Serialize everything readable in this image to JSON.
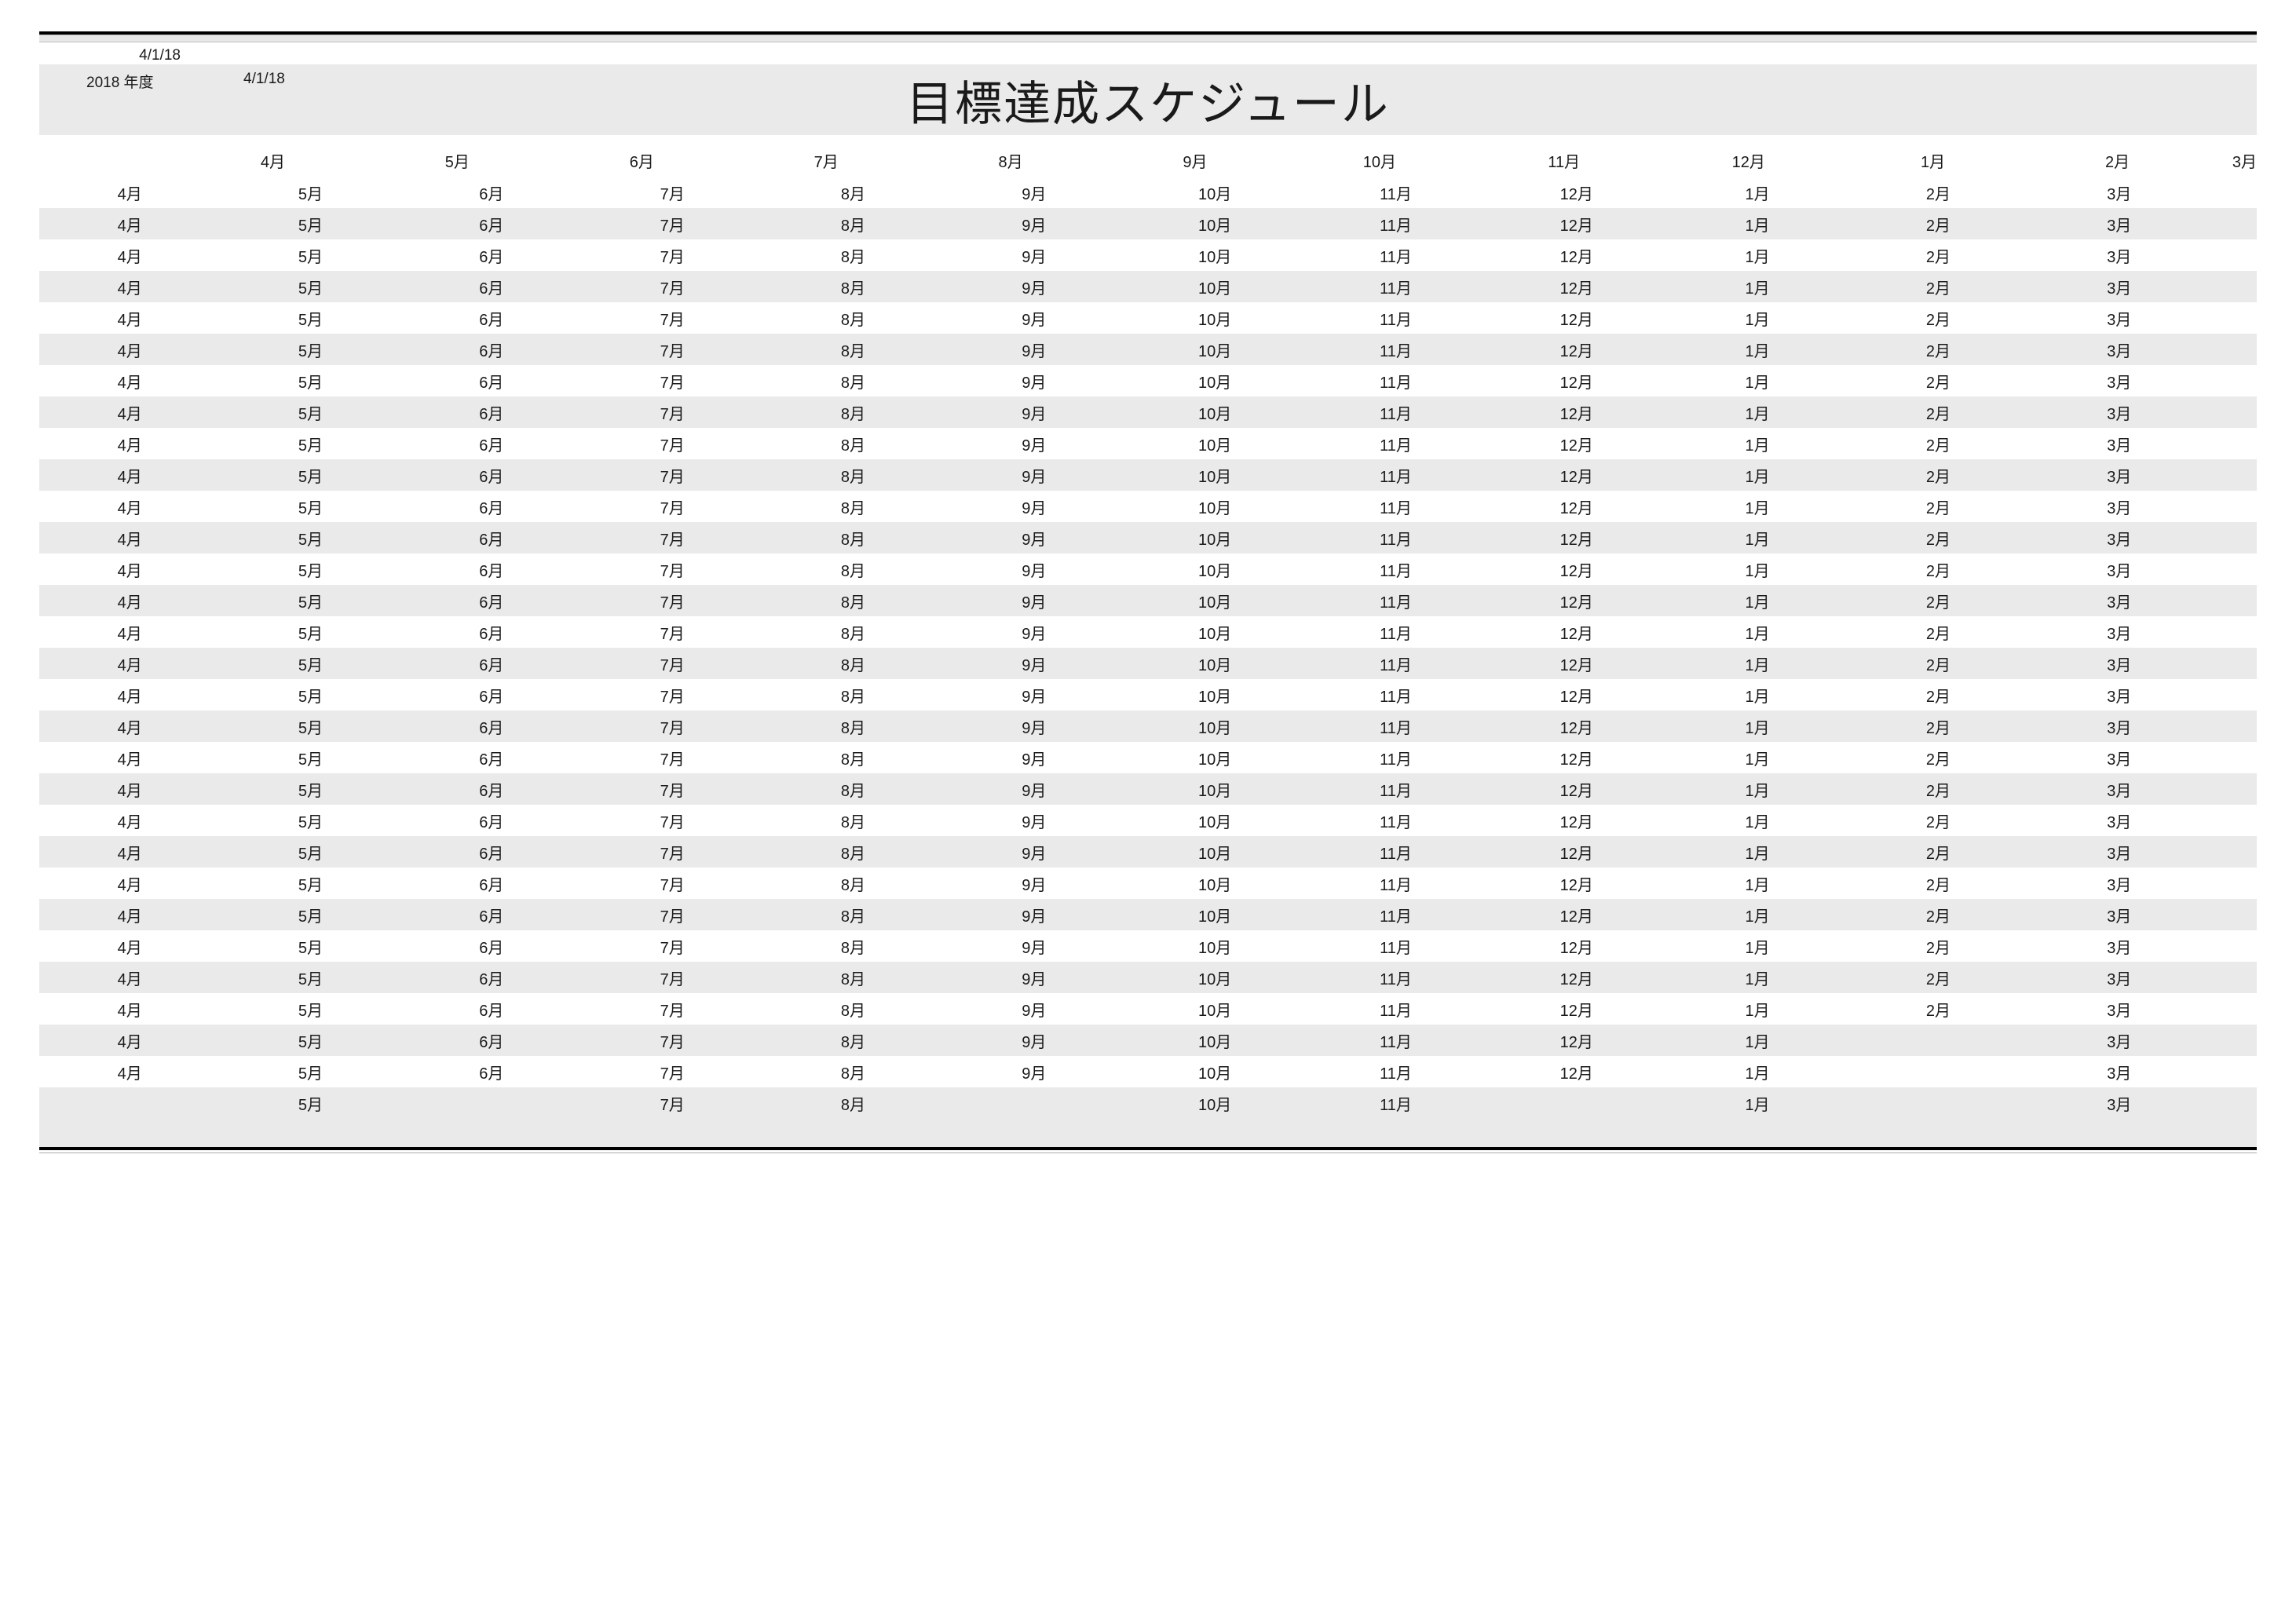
{
  "meta": {
    "date1": "4/1/18",
    "year_label": "2018 年度",
    "date2": "4/1/18",
    "title": "目標達成スケジュール"
  },
  "header_months": [
    "4月",
    "5月",
    "6月",
    "7月",
    "8月",
    "9月",
    "10月",
    "11月",
    "12月",
    "1月",
    "2月"
  ],
  "header_trail": "3月",
  "data_months": [
    "4月",
    "5月",
    "6月",
    "7月",
    "8月",
    "9月",
    "10月",
    "11月",
    "12月",
    "1月",
    "2月",
    "3月"
  ],
  "rows": [
    {
      "omit": []
    },
    {
      "omit": []
    },
    {
      "omit": []
    },
    {
      "omit": []
    },
    {
      "omit": []
    },
    {
      "omit": []
    },
    {
      "omit": []
    },
    {
      "omit": []
    },
    {
      "omit": []
    },
    {
      "omit": []
    },
    {
      "omit": []
    },
    {
      "omit": []
    },
    {
      "omit": []
    },
    {
      "omit": []
    },
    {
      "omit": []
    },
    {
      "omit": []
    },
    {
      "omit": []
    },
    {
      "omit": []
    },
    {
      "omit": []
    },
    {
      "omit": []
    },
    {
      "omit": []
    },
    {
      "omit": []
    },
    {
      "omit": []
    },
    {
      "omit": []
    },
    {
      "omit": []
    },
    {
      "omit": []
    },
    {
      "omit": []
    },
    {
      "omit": [
        10
      ]
    },
    {
      "omit": [
        10
      ]
    },
    {
      "omit": [
        0,
        2,
        5,
        8,
        10
      ]
    }
  ]
}
